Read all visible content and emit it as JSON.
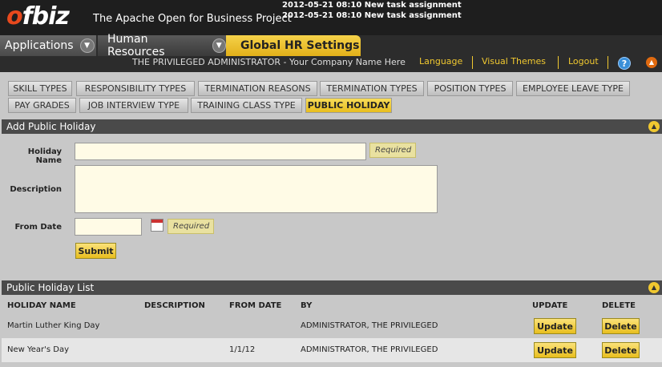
{
  "header": {
    "logo_text": "ofbiz",
    "tagline": "The Apache Open for Business Project",
    "notifications": [
      "2012-05-21 08:10 New task assignment",
      "2012-05-21 08:10 New task assignment"
    ]
  },
  "apptabs": {
    "applications": "Applications",
    "human_resources": "Human Resources",
    "global_hr": "Global HR Settings"
  },
  "userbar": {
    "user": "THE PRIVILEGED ADMINISTRATOR - Your Company Name Here",
    "language": "Language",
    "visual_themes": "Visual Themes",
    "logout": "Logout",
    "help": "?"
  },
  "subtabs": {
    "row1": [
      "SKILL TYPES",
      "RESPONSIBILITY TYPES",
      "TERMINATION REASONS",
      "TERMINATION TYPES",
      "POSITION TYPES",
      "EMPLOYEE LEAVE TYPE"
    ],
    "row2": [
      "PAY GRADES",
      "JOB INTERVIEW TYPE",
      "TRAINING CLASS TYPE",
      "PUBLIC HOLIDAY"
    ],
    "selected": "PUBLIC HOLIDAY"
  },
  "add_form": {
    "title": "Add Public Holiday",
    "holiday_name_label": "Holiday Name",
    "holiday_name_value": "",
    "description_label": "Description",
    "description_value": "",
    "from_date_label": "From Date",
    "from_date_value": "",
    "required": "Required",
    "submit": "Submit"
  },
  "list": {
    "title": "Public Holiday List",
    "columns": [
      "HOLIDAY NAME",
      "DESCRIPTION",
      "FROM DATE",
      "BY",
      "UPDATE",
      "DELETE"
    ],
    "rows": [
      {
        "name": "Martin Luther King Day",
        "description": "",
        "from_date": "",
        "by": "ADMINISTRATOR, THE PRIVILEGED",
        "update": "Update",
        "delete": "Delete"
      },
      {
        "name": "New Year's Day",
        "description": "",
        "from_date": "1/1/12",
        "by": "ADMINISTRATOR, THE PRIVILEGED",
        "update": "Update",
        "delete": "Delete"
      }
    ]
  },
  "colors": {
    "accent": "#f0c830",
    "header_bg": "#1e1e1e",
    "panel_title_bg": "#4a4a4a"
  }
}
